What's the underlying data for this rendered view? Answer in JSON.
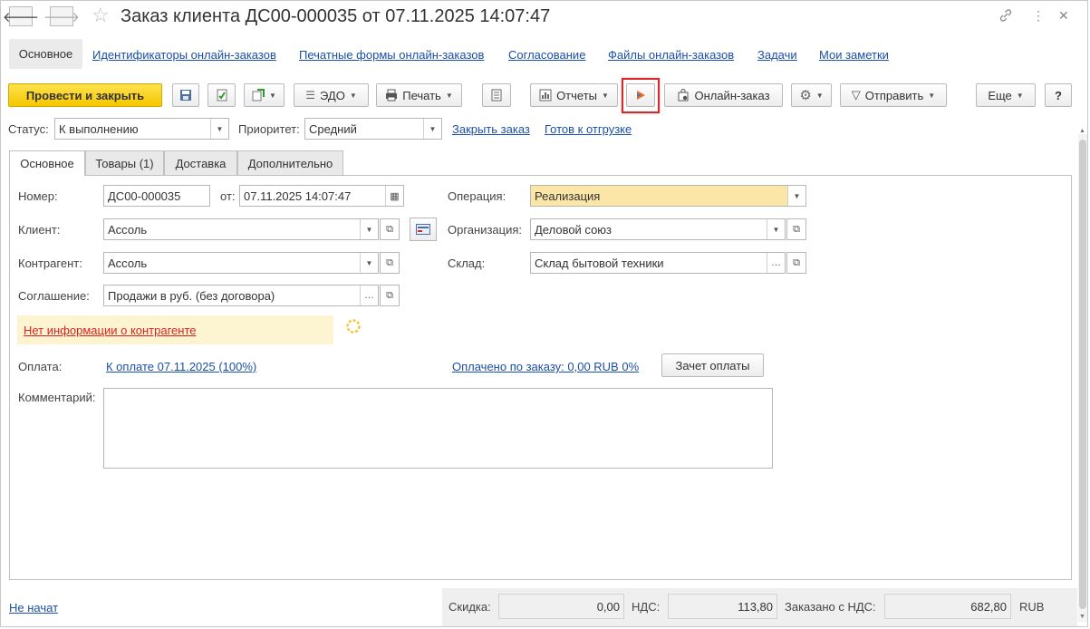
{
  "window": {
    "title": "Заказ клиента ДС00-000035 от 07.11.2025 14:07:47"
  },
  "form_nav": {
    "active": "Основное",
    "links": [
      "Идентификаторы онлайн-заказов",
      "Печатные формы онлайн-заказов",
      "Согласование",
      "Файлы онлайн-заказов",
      "Задачи",
      "Мои заметки"
    ]
  },
  "toolbar": {
    "post_close": "Провести и закрыть",
    "edo": "ЭДО",
    "print": "Печать",
    "reports": "Отчеты",
    "online_order": "Онлайн-заказ",
    "send": "Отправить",
    "more": "Еще",
    "help": "?"
  },
  "status_row": {
    "status_label": "Статус:",
    "status_value": "К выполнению",
    "priority_label": "Приоритет:",
    "priority_value": "Средний",
    "close_order": "Закрыть заказ",
    "ready_ship": "Готов к отгрузке"
  },
  "tabs": [
    "Основное",
    "Товары (1)",
    "Доставка",
    "Дополнительно"
  ],
  "fields": {
    "number_label": "Номер:",
    "number_value": "ДС00-000035",
    "from_label": "от:",
    "date_value": "07.11.2025 14:07:47",
    "operation_label": "Операция:",
    "operation_value": "Реализация",
    "client_label": "Клиент:",
    "client_value": "Ассоль",
    "organization_label": "Организация:",
    "organization_value": "Деловой союз",
    "contractor_label": "Контрагент:",
    "contractor_value": "Ассоль",
    "warehouse_label": "Склад:",
    "warehouse_value": "Склад бытовой техники",
    "agreement_label": "Соглашение:",
    "agreement_value": "Продажи в руб. (без договора)",
    "no_info": "Нет информации о контрагенте",
    "payment_label": "Оплата:",
    "payment_link": "К оплате 07.11.2025 (100%)",
    "paid_link": "Оплачено по заказу: 0,00 RUB 0%",
    "offset_button": "Зачет оплаты",
    "comment_label": "Комментарий:"
  },
  "footer": {
    "state_link": "Не начат",
    "discount_label": "Скидка:",
    "discount_value": "0,00",
    "vat_label": "НДС:",
    "vat_value": "113,80",
    "total_label": "Заказано с НДС:",
    "total_value": "682,80",
    "currency": "RUB"
  },
  "colors": {
    "primary_button": "#f5c700",
    "link": "#1b4fa8",
    "highlight_border": "#d9262a",
    "warning_bg": "#fdf5d2",
    "warning_text": "#e02020",
    "operation_field_bg": "#fbe6a8"
  }
}
